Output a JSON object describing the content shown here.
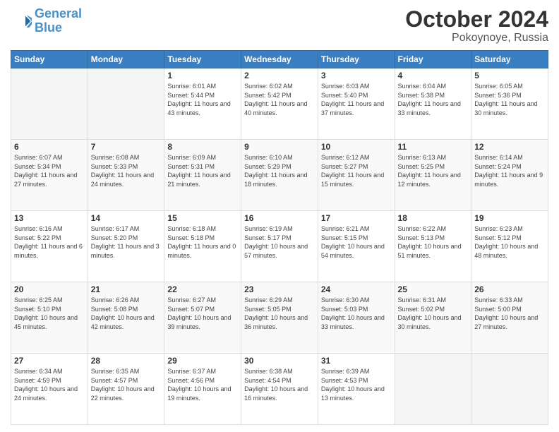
{
  "logo": {
    "line1": "General",
    "line2": "Blue"
  },
  "title": "October 2024",
  "location": "Pokoynoye, Russia",
  "days_header": [
    "Sunday",
    "Monday",
    "Tuesday",
    "Wednesday",
    "Thursday",
    "Friday",
    "Saturday"
  ],
  "weeks": [
    [
      {
        "day": "",
        "info": ""
      },
      {
        "day": "",
        "info": ""
      },
      {
        "day": "1",
        "info": "Sunrise: 6:01 AM\nSunset: 5:44 PM\nDaylight: 11 hours and 43 minutes."
      },
      {
        "day": "2",
        "info": "Sunrise: 6:02 AM\nSunset: 5:42 PM\nDaylight: 11 hours and 40 minutes."
      },
      {
        "day": "3",
        "info": "Sunrise: 6:03 AM\nSunset: 5:40 PM\nDaylight: 11 hours and 37 minutes."
      },
      {
        "day": "4",
        "info": "Sunrise: 6:04 AM\nSunset: 5:38 PM\nDaylight: 11 hours and 33 minutes."
      },
      {
        "day": "5",
        "info": "Sunrise: 6:05 AM\nSunset: 5:36 PM\nDaylight: 11 hours and 30 minutes."
      }
    ],
    [
      {
        "day": "6",
        "info": "Sunrise: 6:07 AM\nSunset: 5:34 PM\nDaylight: 11 hours and 27 minutes."
      },
      {
        "day": "7",
        "info": "Sunrise: 6:08 AM\nSunset: 5:33 PM\nDaylight: 11 hours and 24 minutes."
      },
      {
        "day": "8",
        "info": "Sunrise: 6:09 AM\nSunset: 5:31 PM\nDaylight: 11 hours and 21 minutes."
      },
      {
        "day": "9",
        "info": "Sunrise: 6:10 AM\nSunset: 5:29 PM\nDaylight: 11 hours and 18 minutes."
      },
      {
        "day": "10",
        "info": "Sunrise: 6:12 AM\nSunset: 5:27 PM\nDaylight: 11 hours and 15 minutes."
      },
      {
        "day": "11",
        "info": "Sunrise: 6:13 AM\nSunset: 5:25 PM\nDaylight: 11 hours and 12 minutes."
      },
      {
        "day": "12",
        "info": "Sunrise: 6:14 AM\nSunset: 5:24 PM\nDaylight: 11 hours and 9 minutes."
      }
    ],
    [
      {
        "day": "13",
        "info": "Sunrise: 6:16 AM\nSunset: 5:22 PM\nDaylight: 11 hours and 6 minutes."
      },
      {
        "day": "14",
        "info": "Sunrise: 6:17 AM\nSunset: 5:20 PM\nDaylight: 11 hours and 3 minutes."
      },
      {
        "day": "15",
        "info": "Sunrise: 6:18 AM\nSunset: 5:18 PM\nDaylight: 11 hours and 0 minutes."
      },
      {
        "day": "16",
        "info": "Sunrise: 6:19 AM\nSunset: 5:17 PM\nDaylight: 10 hours and 57 minutes."
      },
      {
        "day": "17",
        "info": "Sunrise: 6:21 AM\nSunset: 5:15 PM\nDaylight: 10 hours and 54 minutes."
      },
      {
        "day": "18",
        "info": "Sunrise: 6:22 AM\nSunset: 5:13 PM\nDaylight: 10 hours and 51 minutes."
      },
      {
        "day": "19",
        "info": "Sunrise: 6:23 AM\nSunset: 5:12 PM\nDaylight: 10 hours and 48 minutes."
      }
    ],
    [
      {
        "day": "20",
        "info": "Sunrise: 6:25 AM\nSunset: 5:10 PM\nDaylight: 10 hours and 45 minutes."
      },
      {
        "day": "21",
        "info": "Sunrise: 6:26 AM\nSunset: 5:08 PM\nDaylight: 10 hours and 42 minutes."
      },
      {
        "day": "22",
        "info": "Sunrise: 6:27 AM\nSunset: 5:07 PM\nDaylight: 10 hours and 39 minutes."
      },
      {
        "day": "23",
        "info": "Sunrise: 6:29 AM\nSunset: 5:05 PM\nDaylight: 10 hours and 36 minutes."
      },
      {
        "day": "24",
        "info": "Sunrise: 6:30 AM\nSunset: 5:03 PM\nDaylight: 10 hours and 33 minutes."
      },
      {
        "day": "25",
        "info": "Sunrise: 6:31 AM\nSunset: 5:02 PM\nDaylight: 10 hours and 30 minutes."
      },
      {
        "day": "26",
        "info": "Sunrise: 6:33 AM\nSunset: 5:00 PM\nDaylight: 10 hours and 27 minutes."
      }
    ],
    [
      {
        "day": "27",
        "info": "Sunrise: 6:34 AM\nSunset: 4:59 PM\nDaylight: 10 hours and 24 minutes."
      },
      {
        "day": "28",
        "info": "Sunrise: 6:35 AM\nSunset: 4:57 PM\nDaylight: 10 hours and 22 minutes."
      },
      {
        "day": "29",
        "info": "Sunrise: 6:37 AM\nSunset: 4:56 PM\nDaylight: 10 hours and 19 minutes."
      },
      {
        "day": "30",
        "info": "Sunrise: 6:38 AM\nSunset: 4:54 PM\nDaylight: 10 hours and 16 minutes."
      },
      {
        "day": "31",
        "info": "Sunrise: 6:39 AM\nSunset: 4:53 PM\nDaylight: 10 hours and 13 minutes."
      },
      {
        "day": "",
        "info": ""
      },
      {
        "day": "",
        "info": ""
      }
    ]
  ]
}
